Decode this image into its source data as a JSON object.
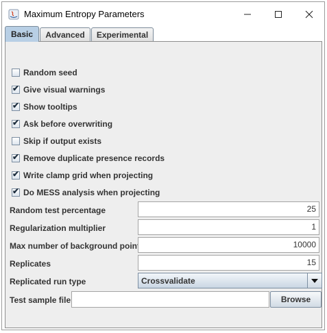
{
  "window": {
    "title": "Maximum Entropy Parameters"
  },
  "tabs": [
    {
      "label": "Basic",
      "active": true
    },
    {
      "label": "Advanced",
      "active": false
    },
    {
      "label": "Experimental",
      "active": false
    }
  ],
  "options": [
    {
      "label": "Random seed",
      "checked": false
    },
    {
      "label": "Give visual warnings",
      "checked": true
    },
    {
      "label": "Show tooltips",
      "checked": true
    },
    {
      "label": "Ask before overwriting",
      "checked": true
    },
    {
      "label": "Skip if output exists",
      "checked": false
    },
    {
      "label": "Remove duplicate presence records",
      "checked": true
    },
    {
      "label": "Write clamp grid when projecting",
      "checked": true
    },
    {
      "label": "Do MESS analysis when projecting",
      "checked": true
    }
  ],
  "fields": [
    {
      "label": "Random test percentage",
      "value": "25"
    },
    {
      "label": "Regularization multiplier",
      "value": "1"
    },
    {
      "label": "Max number of background points",
      "value": "10000"
    },
    {
      "label": "Replicates",
      "value": "15"
    }
  ],
  "run_type": {
    "label": "Replicated run type",
    "value": "Crossvalidate"
  },
  "test_sample": {
    "label": "Test sample file",
    "value": "",
    "button_label": "Browse"
  },
  "colors": {
    "active_tab": "#b8cfe5",
    "panel": "#eeeeee",
    "accent_border": "#7c8ea1"
  }
}
